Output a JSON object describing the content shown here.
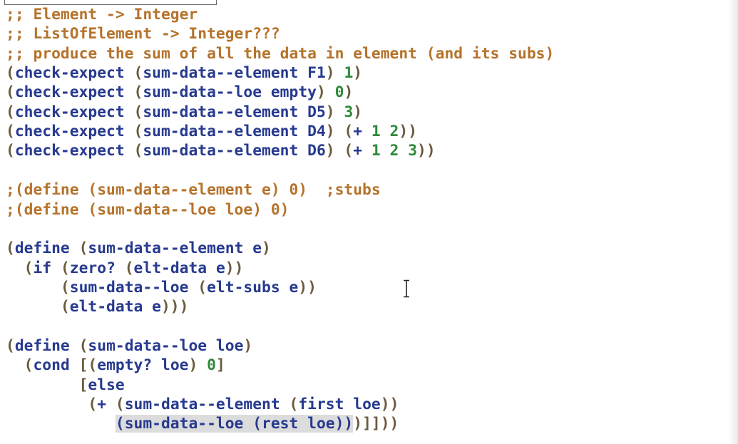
{
  "lines": [
    [
      [
        "cmt",
        ";; Element -> Integer"
      ]
    ],
    [
      [
        "cmt",
        ";; ListOfElement -> Integer???"
      ]
    ],
    [
      [
        "cmt",
        ";; produce the sum of all the data in element (and its subs)"
      ]
    ],
    [
      [
        "par",
        "("
      ],
      [
        "id",
        "check-expect "
      ],
      [
        "par",
        "("
      ],
      [
        "id",
        "sum-data--element F1"
      ],
      [
        "par",
        ") "
      ],
      [
        "num",
        "1"
      ],
      [
        "par",
        ")"
      ]
    ],
    [
      [
        "par",
        "("
      ],
      [
        "id",
        "check-expect "
      ],
      [
        "par",
        "("
      ],
      [
        "id",
        "sum-data--loe empty"
      ],
      [
        "par",
        ") "
      ],
      [
        "num",
        "0"
      ],
      [
        "par",
        ")"
      ]
    ],
    [
      [
        "par",
        "("
      ],
      [
        "id",
        "check-expect "
      ],
      [
        "par",
        "("
      ],
      [
        "id",
        "sum-data--element D5"
      ],
      [
        "par",
        ") "
      ],
      [
        "num",
        "3"
      ],
      [
        "par",
        ")"
      ]
    ],
    [
      [
        "par",
        "("
      ],
      [
        "id",
        "check-expect "
      ],
      [
        "par",
        "("
      ],
      [
        "id",
        "sum-data--element D4"
      ],
      [
        "par",
        ") ("
      ],
      [
        "id",
        "+ "
      ],
      [
        "num",
        "1 2"
      ],
      [
        "par",
        "))"
      ]
    ],
    [
      [
        "par",
        "("
      ],
      [
        "id",
        "check-expect "
      ],
      [
        "par",
        "("
      ],
      [
        "id",
        "sum-data--element D6"
      ],
      [
        "par",
        ") ("
      ],
      [
        "id",
        "+ "
      ],
      [
        "num",
        "1 2 3"
      ],
      [
        "par",
        "))"
      ]
    ],
    [],
    [
      [
        "cmt",
        ";(define (sum-data--element e) 0)  ;stubs"
      ]
    ],
    [
      [
        "cmt",
        ";(define (sum-data--loe loe) 0)"
      ]
    ],
    [],
    [
      [
        "par",
        "("
      ],
      [
        "id",
        "define "
      ],
      [
        "par",
        "("
      ],
      [
        "id",
        "sum-data--element e"
      ],
      [
        "par",
        ")"
      ]
    ],
    [
      [
        "id",
        "  "
      ],
      [
        "par",
        "("
      ],
      [
        "id",
        "if "
      ],
      [
        "par",
        "("
      ],
      [
        "id",
        "zero? "
      ],
      [
        "par",
        "("
      ],
      [
        "id",
        "elt-data e"
      ],
      [
        "par",
        "))"
      ]
    ],
    [
      [
        "id",
        "      "
      ],
      [
        "par",
        "("
      ],
      [
        "id",
        "sum-data--loe "
      ],
      [
        "par",
        "("
      ],
      [
        "id",
        "elt-subs e"
      ],
      [
        "par",
        "))"
      ]
    ],
    [
      [
        "id",
        "      "
      ],
      [
        "par",
        "("
      ],
      [
        "id",
        "elt-data e"
      ],
      [
        "par",
        ")))"
      ]
    ],
    [],
    [
      [
        "par",
        "("
      ],
      [
        "id",
        "define "
      ],
      [
        "par",
        "("
      ],
      [
        "id",
        "sum-data--loe loe"
      ],
      [
        "par",
        ")"
      ]
    ],
    [
      [
        "id",
        "  "
      ],
      [
        "par",
        "("
      ],
      [
        "id",
        "cond "
      ],
      [
        "par",
        "[("
      ],
      [
        "id",
        "empty? loe"
      ],
      [
        "par",
        ") "
      ],
      [
        "num",
        "0"
      ],
      [
        "par",
        "]"
      ]
    ],
    [
      [
        "id",
        "        "
      ],
      [
        "par",
        "["
      ],
      [
        "id",
        "else"
      ]
    ],
    [
      [
        "id",
        "         "
      ],
      [
        "par",
        "("
      ],
      [
        "id",
        "+ "
      ],
      [
        "par",
        "("
      ],
      [
        "id",
        "sum-data--element "
      ],
      [
        "par",
        "("
      ],
      [
        "id",
        "first loe"
      ],
      [
        "par",
        "))"
      ]
    ],
    [
      [
        "id",
        "            "
      ],
      [
        "hl",
        "(sum-data--loe (rest loe))"
      ],
      [
        "par",
        ")]]))"
      ]
    ]
  ]
}
